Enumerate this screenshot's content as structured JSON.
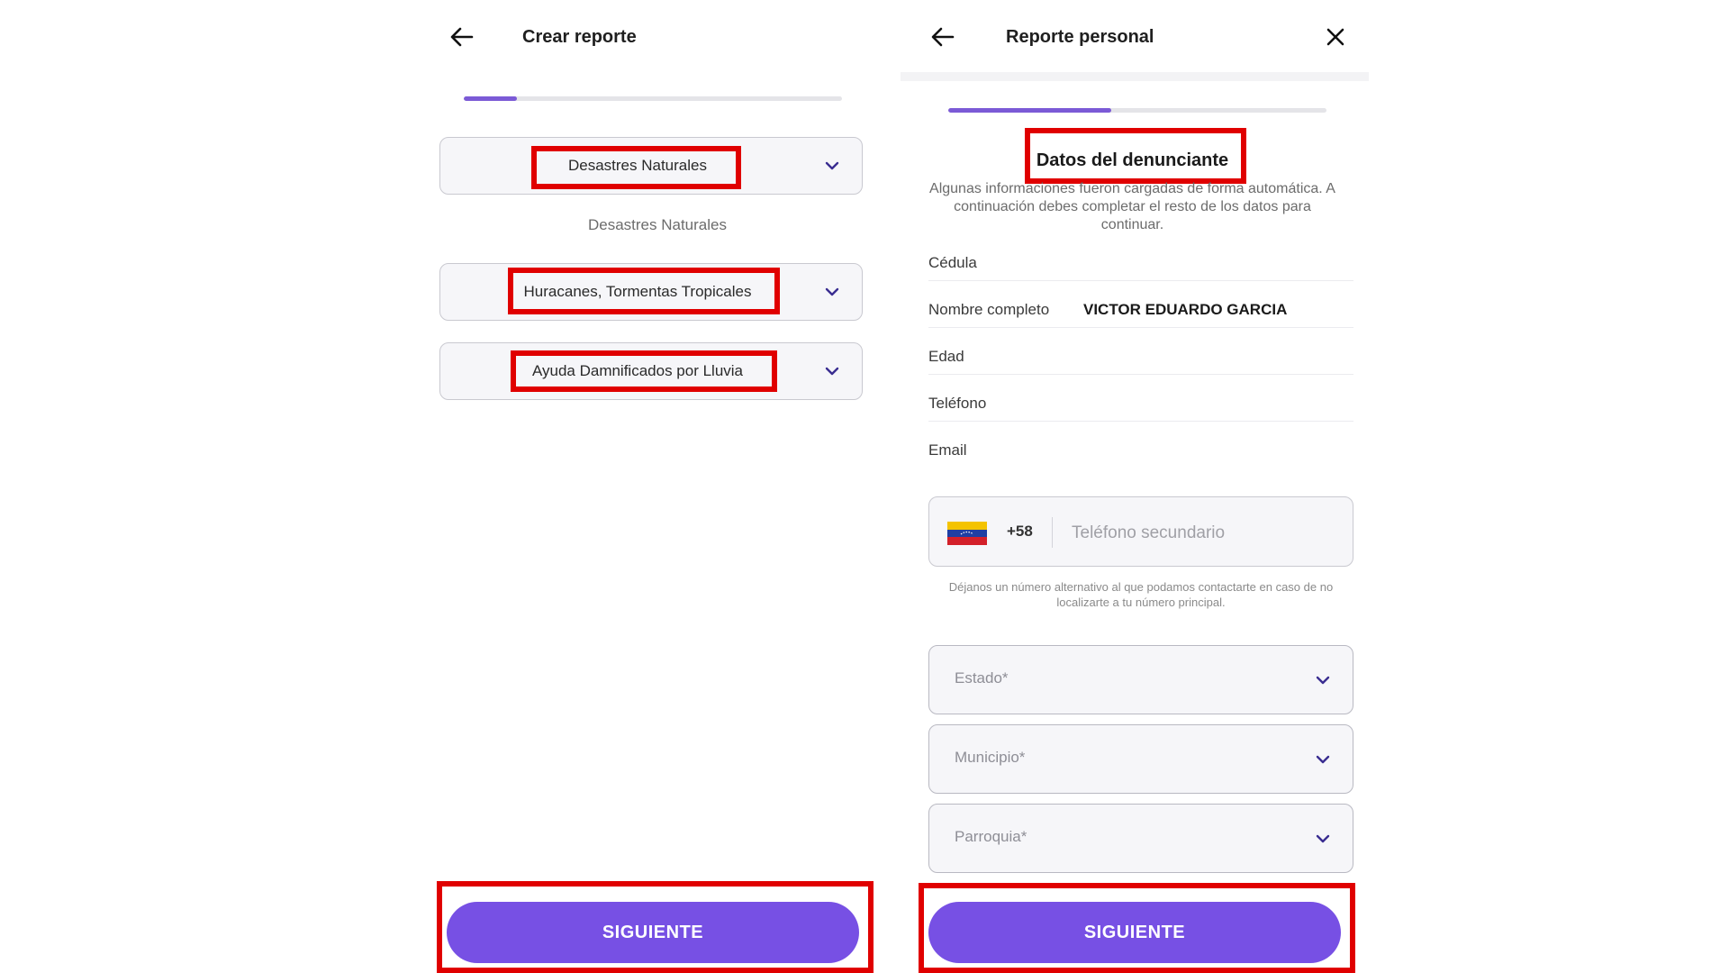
{
  "left": {
    "title": "Crear reporte",
    "progress": 0.14,
    "category_select": "Desastres Naturales",
    "category_caption": "Desastres Naturales",
    "subcategory_select": "Huracanes, Tormentas Tropicales",
    "type_select": "Ayuda Damnificados por Lluvia",
    "next_label": "SIGUIENTE"
  },
  "right": {
    "title": "Reporte personal",
    "progress": 0.43,
    "section_title": "Datos del denunciante",
    "section_desc": "Algunas informaciones fueron cargadas de forma automática. A continuación debes completar el resto de los datos para continuar.",
    "fields": [
      {
        "label": "Cédula",
        "value": ""
      },
      {
        "label": "Nombre completo",
        "value": "VICTOR EDUARDO GARCIA"
      },
      {
        "label": "Edad",
        "value": ""
      },
      {
        "label": "Teléfono",
        "value": ""
      },
      {
        "label": "Email",
        "value": ""
      }
    ],
    "phone": {
      "country_code": "+58",
      "value": "",
      "placeholder": "Teléfono secundario",
      "hint": "Déjanos un número alternativo al que podamos contactarte en caso de no localizarte a tu número principal."
    },
    "state_placeholder": "Estado*",
    "municipality_placeholder": "Municipio*",
    "parish_placeholder": "Parroquia*",
    "next_label": "SIGUIENTE"
  },
  "colors": {
    "accent": "#7750e4",
    "progress": "#7b5ad6",
    "highlight": "#e00000"
  },
  "icons": [
    "back-arrow-icon",
    "close-icon",
    "chevron-down-icon",
    "venezuela-flag-icon"
  ]
}
